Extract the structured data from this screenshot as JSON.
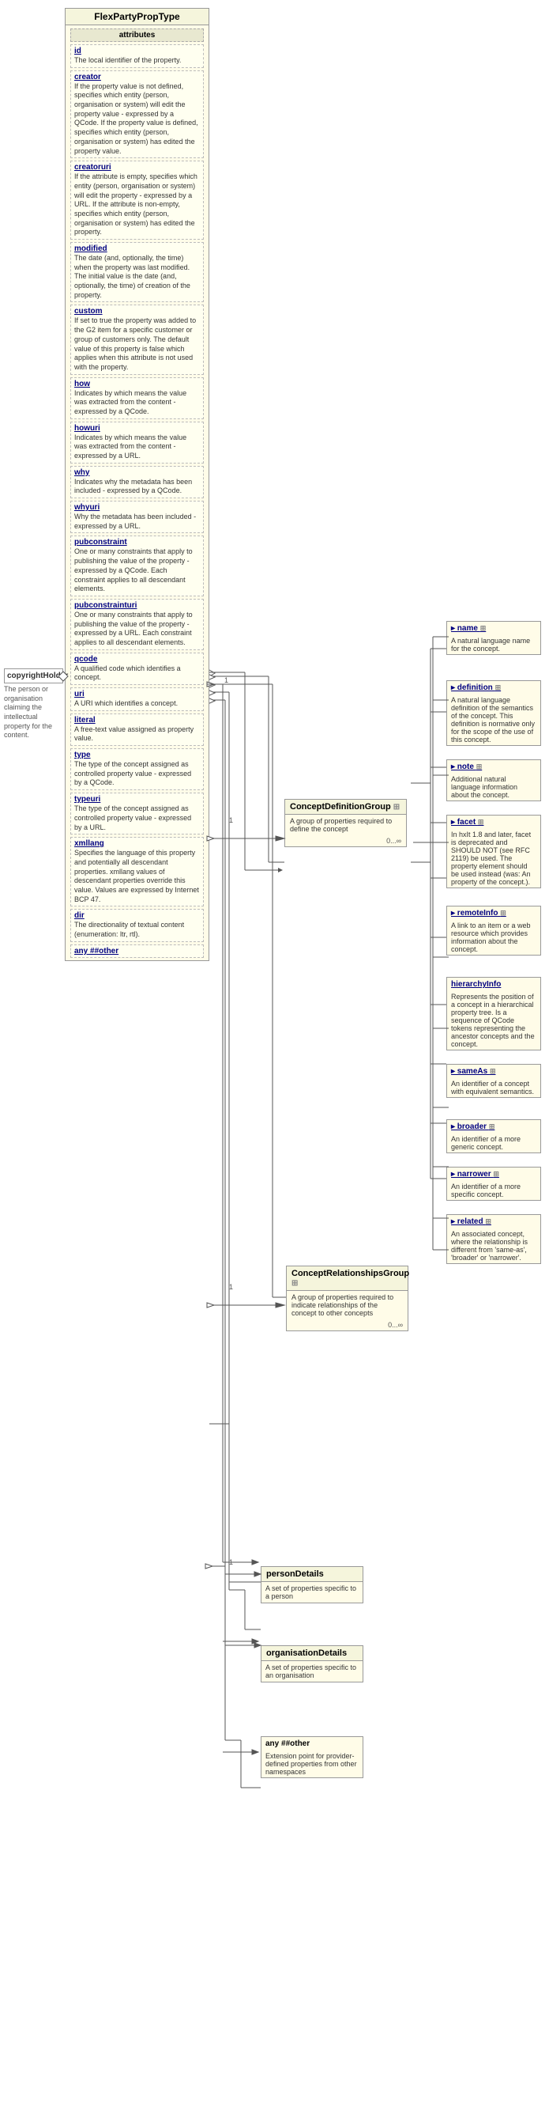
{
  "title": "FlexPartyPropType",
  "mainBox": {
    "title": "FlexPartyPropType",
    "sectionLabel": "attributes",
    "properties": [
      {
        "name": "id",
        "desc": "The local identifier of the property."
      },
      {
        "name": "creator",
        "desc": "If the property value is not defined, specifies which entity (person, organisation or system) will edit the property value - expressed by a QCode. If the property value is defined, specifies which entity (person, organisation or system) has edited the property value."
      },
      {
        "name": "creatoruri",
        "desc": "If the attribute is empty, specifies which entity (person, organisation or system) will edit the property - expressed by a URL. If the attribute is non-empty, specifies which entity (person, organisation or system) has edited the property."
      },
      {
        "name": "modified",
        "desc": "The date (and, optionally, the time) when the property was last modified. The initial value is the date (and, optionally, the time) of creation of the property."
      },
      {
        "name": "custom",
        "desc": "If set to true the property was added to the G2 item for a specific customer or group of customers only. The default value of this property is false which applies when this attribute is not used with the property."
      },
      {
        "name": "how",
        "desc": "Indicates by which means the value was extracted from the content - expressed by a QCode."
      },
      {
        "name": "howuri",
        "desc": "Indicates by which means the value was extracted from the content - expressed by a URL."
      },
      {
        "name": "why",
        "desc": "Indicates why the metadata has been included - expressed by a QCode."
      },
      {
        "name": "whyuri",
        "desc": "Why the metadata has been included - expressed by a URL."
      },
      {
        "name": "pubconstraint",
        "desc": "One or many constraints that apply to publishing the value of the property - expressed by a QCode. Each constraint applies to all descendant elements."
      },
      {
        "name": "pubconstrainturi",
        "desc": "One or many constraints that apply to publishing the value of the property - expressed by a URL. Each constraint applies to all descendant elements."
      },
      {
        "name": "qcode",
        "desc": "A qualified code which identifies a concept."
      },
      {
        "name": "uri",
        "desc": "A URI which identifies a concept."
      },
      {
        "name": "literal",
        "desc": "A free-text value assigned as property value."
      },
      {
        "name": "type",
        "desc": "The type of the concept assigned as controlled property value - expressed by a QCode."
      },
      {
        "name": "typeuri",
        "desc": "The type of the concept assigned as controlled property value - expressed by a URL."
      },
      {
        "name": "xmllang",
        "desc": "Specifies the language of this property and potentially all descendant properties. xmllang values of descendant properties override this value. Values are expressed by Internet BCP 47."
      },
      {
        "name": "dir",
        "desc": "The directionality of textual content (enumeration: ltr, rtl)."
      },
      {
        "name": "any ##other",
        "desc": ""
      }
    ]
  },
  "leftLabel": {
    "text": "copyrightHolder",
    "desc": "The person or organisation claiming the intellectual property for the content."
  },
  "conceptDefinitionGroup": {
    "title": "ConceptDefinitionGroup",
    "desc": "A group of properties required to define the concept",
    "multiplicity": "0...∞",
    "properties": [
      {
        "name": "name",
        "desc": "A natural language name for the concept.",
        "indicator": "+"
      },
      {
        "name": "definition",
        "desc": "A natural language definition of the semantics of the concept. This definition is normative only for the scope of the use of this concept.",
        "indicator": "+"
      },
      {
        "name": "note",
        "desc": "Additional natural language information about the concept.",
        "indicator": "+"
      },
      {
        "name": "facet",
        "desc": "In hxIt 1.8 and later, facet is deprecated and SHOULD NOT (see RFC 2119) be used. The property element should be used instead (was: An property of the concept.).",
        "indicator": "+"
      },
      {
        "name": "remoteInfo",
        "desc": "A link to an item or a web resource which provides information about the concept.",
        "indicator": "+"
      },
      {
        "name": "hierarchyInfo",
        "desc": "Represents the position of a concept in a hierarchical property tree. Is a sequence of QCode tokens representing the ancestor concepts and the concept."
      },
      {
        "name": "sameAs",
        "desc": "An identifier of a concept with equivalent semantics.",
        "indicator": "+"
      },
      {
        "name": "broader",
        "desc": "An identifier of a more generic concept.",
        "indicator": "+"
      },
      {
        "name": "narrower",
        "desc": "An identifier of a more specific concept.",
        "indicator": "+"
      },
      {
        "name": "related",
        "desc": "An associated concept, where the relationship is different from 'same-as', 'broader' or 'narrower'.",
        "indicator": "+"
      }
    ]
  },
  "conceptRelationshipsGroup": {
    "title": "ConceptRelationshipsGroup",
    "desc": "A group of properties required to indicate relationships of the concept to other concepts",
    "multiplicity": "0...∞"
  },
  "personDetails": {
    "title": "personDetails",
    "desc": "A set of properties specific to a person",
    "multiplicity": ""
  },
  "organisationDetails": {
    "title": "organisationDetails",
    "desc": "A set of properties specific to an organisation",
    "multiplicity": ""
  },
  "anyOther": {
    "label": "any ##other",
    "desc": "Extension point for provider-defined properties from other namespaces"
  },
  "connectors": {
    "mainToConceptDef": "1",
    "mainToConceptRel": "1",
    "mainToPerson": "1",
    "mainToOrg": "1"
  }
}
